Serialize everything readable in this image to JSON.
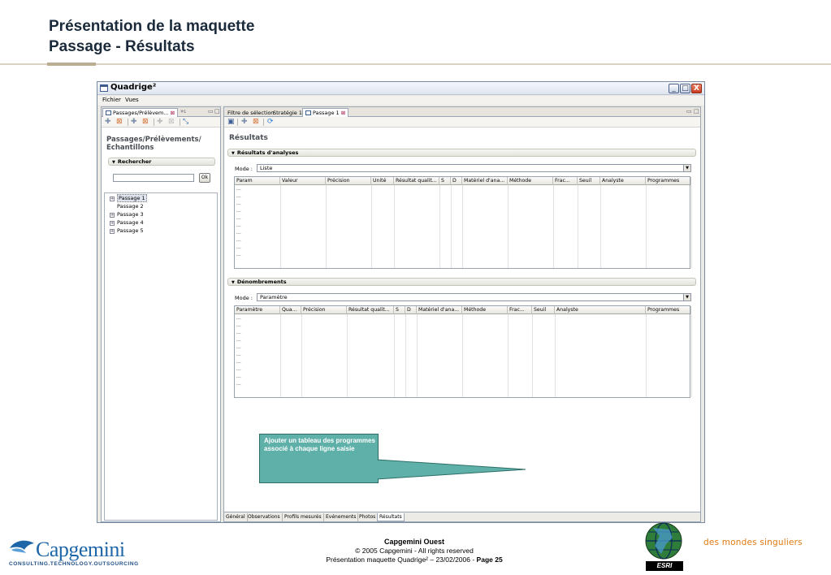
{
  "slide": {
    "title_line1": "Présentation de la maquette",
    "title_line2": "Passage - Résultats"
  },
  "window": {
    "title": "Quadrige²",
    "menu": [
      "Fichier",
      "Vues"
    ],
    "controls": {
      "minimize": "_",
      "maximize": "□",
      "close": "X"
    }
  },
  "left_panel": {
    "tab_label": "Passages/Prélèvem...",
    "tab_extra": "»₁",
    "heading_line1": "Passages/Prélèvements/",
    "heading_line2": "Echantillons",
    "search_section": "Rechercher",
    "search_value": "",
    "ok_label": "Ok",
    "tree": [
      {
        "label": "Passage 1",
        "expandable": true,
        "selected": true
      },
      {
        "label": "Passage 2",
        "expandable": false,
        "selected": false
      },
      {
        "label": "Passage 3",
        "expandable": true,
        "selected": false
      },
      {
        "label": "Passage 4",
        "expandable": true,
        "selected": false
      },
      {
        "label": "Passage 5",
        "expandable": true,
        "selected": false
      }
    ]
  },
  "right_panel": {
    "tabs": [
      "Filtre de sélection",
      "Stratégie 1",
      "Passage 1"
    ],
    "title": "Résultats",
    "sections": [
      {
        "header": "Résultats d'analyses",
        "mode_label": "Mode :",
        "mode_value": "Liste",
        "columns": [
          "Param",
          "Valeur",
          "Précision",
          "Unité",
          "Résultat qualit...",
          "S",
          "D",
          "Matériel d'ana...",
          "Méthode",
          "Frac...",
          "Seuil",
          "Analyste",
          "Programmes"
        ],
        "rows": [
          "...",
          "...",
          "...",
          "...",
          "...",
          "...",
          "...",
          "...",
          "...",
          "..."
        ]
      },
      {
        "header": "Dénombrements",
        "mode_label": "Mode :",
        "mode_value": "Paramètre",
        "columns": [
          "Paramètre",
          "Qua...",
          "Précision",
          "Résultat qualit...",
          "S",
          "D",
          "Matériel d'ana...",
          "Méthode",
          "Frac...",
          "Seuil",
          "Analyste",
          "Programmes"
        ],
        "rows": [
          "...",
          "...",
          "...",
          "...",
          "...",
          "...",
          "...",
          "...",
          "...",
          "..."
        ]
      }
    ],
    "bottom_tabs": [
      "Général",
      "Observations",
      "Profils mesurés",
      "Evénements",
      "Photos",
      "Résultats"
    ],
    "active_bottom_tab": "Résultats"
  },
  "callout": {
    "text": "Ajouter un tableau des programmes associé à chaque ligne saisie",
    "color": "#5fb0a9"
  },
  "footer": {
    "org": "Capgemini Ouest",
    "copyright": "© 2005 Capgemini - All rights reserved",
    "caption": "Présentation maquette Quadrige² – 23/02/2006 - ",
    "page": "Page 25"
  },
  "logos": {
    "capgemini_word": "Capgemini",
    "capgemini_tag": "CONSULTING.TECHNOLOGY.OUTSOURCING",
    "esri": "ESRI",
    "tagline": "des mondes singuliers"
  }
}
